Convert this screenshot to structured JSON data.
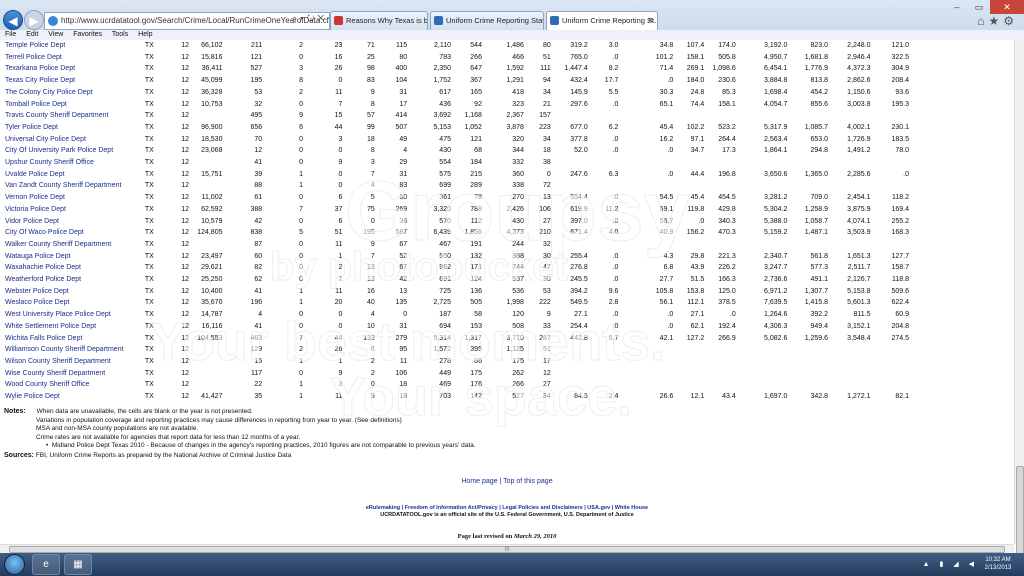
{
  "browser": {
    "url": "http://www.ucrdatatool.gov/Search/Crime/Local/RunCrimeOneYearofData.cfm",
    "tabs": [
      {
        "label": "Reasons Why Texas is better th...",
        "active": false
      },
      {
        "label": "Uniform Crime Reporting Stati...",
        "active": false
      },
      {
        "label": "Uniform Crime Reporting St...",
        "active": true
      }
    ],
    "menu": [
      "File",
      "Edit",
      "View",
      "Favorites",
      "Tools",
      "Help"
    ]
  },
  "table": {
    "rows": [
      [
        "Temple Police Dept",
        "TX",
        "12",
        "66,102",
        "211",
        "2",
        "23",
        "71",
        "115",
        "2,110",
        "544",
        "1,486",
        "80",
        "319.2",
        "3.0",
        "34.8",
        "107.4",
        "174.0",
        "3,192.0",
        "823.0",
        "2,248.0",
        "121.0"
      ],
      [
        "Terrell Police Dept",
        "TX",
        "12",
        "15,816",
        "121",
        "0",
        "16",
        "25",
        "80",
        "783",
        "266",
        "466",
        "51",
        "765.0",
        ".0",
        "101.2",
        "158.1",
        "505.8",
        "4,950.7",
        "1,681.8",
        "2,946.4",
        "322.5"
      ],
      [
        "Texarkana Police Dept",
        "TX",
        "12",
        "36,411",
        "527",
        "3",
        "26",
        "98",
        "400",
        "2,350",
        "647",
        "1,592",
        "111",
        "1,447.4",
        "8.2",
        "71.4",
        "269.1",
        "1,098.6",
        "6,454.1",
        "1,776.9",
        "4,372.3",
        "304.9"
      ],
      [
        "Texas City Police Dept",
        "TX",
        "12",
        "45,099",
        "195",
        "8",
        "0",
        "83",
        "104",
        "1,752",
        "367",
        "1,291",
        "94",
        "432.4",
        "17.7",
        ".0",
        "184.0",
        "230.6",
        "3,884.8",
        "813.8",
        "2,862.6",
        "208.4"
      ],
      [
        "The Colony City Police Dept",
        "TX",
        "12",
        "36,328",
        "53",
        "2",
        "11",
        "9",
        "31",
        "617",
        "165",
        "418",
        "34",
        "145.9",
        "5.5",
        "30.3",
        "24.8",
        "85.3",
        "1,698.4",
        "454.2",
        "1,150.6",
        "93.6"
      ],
      [
        "Tomball Police Dept",
        "TX",
        "12",
        "10,753",
        "32",
        "0",
        "7",
        "8",
        "17",
        "436",
        "92",
        "323",
        "21",
        "297.6",
        ".0",
        "65.1",
        "74.4",
        "158.1",
        "4,054.7",
        "855.6",
        "3,003.8",
        "195.3"
      ],
      [
        "Travis County Sheriff Department",
        "TX",
        "12",
        "",
        "495",
        "9",
        "15",
        "57",
        "414",
        "3,692",
        "1,168",
        "2,367",
        "157",
        "",
        "",
        "",
        "",
        "",
        "",
        "",
        "",
        ""
      ],
      [
        "Tyler Police Dept",
        "TX",
        "12",
        "96,900",
        "656",
        "6",
        "44",
        "99",
        "507",
        "5,153",
        "1,052",
        "3,878",
        "223",
        "677.0",
        "6.2",
        "45.4",
        "102.2",
        "523.2",
        "5,317.9",
        "1,085.7",
        "4,002.1",
        "230.1"
      ],
      [
        "Universal City Police Dept",
        "TX",
        "12",
        "18,530",
        "70",
        "0",
        "3",
        "18",
        "49",
        "475",
        "121",
        "320",
        "34",
        "377.8",
        ".0",
        "16.2",
        "97.1",
        "264.4",
        "2,563.4",
        "653.0",
        "1,726.9",
        "183.5"
      ],
      [
        "City Of University Park Police Dept",
        "TX",
        "12",
        "23,068",
        "12",
        "0",
        "0",
        "8",
        "4",
        "430",
        "68",
        "344",
        "18",
        "52.0",
        ".0",
        ".0",
        "34.7",
        "17.3",
        "1,864.1",
        "294.8",
        "1,491.2",
        "78.0"
      ],
      [
        "Upshur County Sheriff Office",
        "TX",
        "12",
        "",
        "41",
        "0",
        "9",
        "3",
        "29",
        "554",
        "184",
        "332",
        "38",
        "",
        "",
        "",
        "",
        "",
        "",
        "",
        "",
        ""
      ],
      [
        "Uvalde Police Dept",
        "TX",
        "12",
        "15,751",
        "39",
        "1",
        "0",
        "7",
        "31",
        "575",
        "215",
        "360",
        "0",
        "247.6",
        "6.3",
        ".0",
        "44.4",
        "196.8",
        "3,650.6",
        "1,365.0",
        "2,285.6",
        ".0"
      ],
      [
        "Van Zandt County Sheriff Department",
        "TX",
        "12",
        "",
        "88",
        "1",
        "0",
        "4",
        "83",
        "699",
        "289",
        "338",
        "72",
        "",
        "",
        "",
        "",
        "",
        "",
        "",
        "",
        ""
      ],
      [
        "Vernon Police Dept",
        "TX",
        "12",
        "11,002",
        "61",
        "0",
        "6",
        "5",
        "50",
        "361",
        "78",
        "270",
        "13",
        "554.4",
        ".0",
        "54.5",
        "45.4",
        "454.5",
        "3,281.2",
        "709.0",
        "2,454.1",
        "118.2"
      ],
      [
        "Victoria Police Dept",
        "TX",
        "12",
        "62,592",
        "388",
        "7",
        "37",
        "75",
        "269",
        "3,320",
        "788",
        "2,426",
        "106",
        "619.9",
        "11.2",
        "59.1",
        "119.8",
        "429.8",
        "5,304.2",
        "1,258.9",
        "3,875.9",
        "169.4"
      ],
      [
        "Vidor Police Dept",
        "TX",
        "12",
        "10,579",
        "42",
        "0",
        "6",
        "0",
        "36",
        "570",
        "112",
        "430",
        "27",
        "397.0",
        ".0",
        "56.7",
        ".0",
        "340.3",
        "5,388.0",
        "1,058.7",
        "4,074.1",
        "255.2"
      ],
      [
        "City Of Waco Police Dept",
        "TX",
        "12",
        "124,805",
        "838",
        "5",
        "51",
        "195",
        "587",
        "6,439",
        "1,856",
        "4,373",
        "210",
        "671.4",
        "4.0",
        "40.9",
        "156.2",
        "470.3",
        "5,159.2",
        "1,487.1",
        "3,503.9",
        "168.3"
      ],
      [
        "Walker County Sheriff Department",
        "TX",
        "12",
        "",
        "87",
        "0",
        "11",
        "9",
        "67",
        "467",
        "191",
        "244",
        "32",
        "",
        "",
        "",
        "",
        "",
        "",
        "",
        "",
        ""
      ],
      [
        "Watauga Police Dept",
        "TX",
        "12",
        "23,497",
        "60",
        "0",
        "1",
        "7",
        "52",
        "550",
        "132",
        "388",
        "30",
        "255.4",
        ".0",
        "4.3",
        "29.8",
        "221.3",
        "2,340.7",
        "561.8",
        "1,651.3",
        "127.7"
      ],
      [
        "Waxahachie Police Dept",
        "TX",
        "12",
        "29,621",
        "82",
        "0",
        "2",
        "13",
        "67",
        "962",
        "171",
        "744",
        "47",
        "276.8",
        ".0",
        "6.8",
        "43.9",
        "226.2",
        "3,247.7",
        "577.3",
        "2,511.7",
        "158.7"
      ],
      [
        "Weatherford Police Dept",
        "TX",
        "12",
        "25,250",
        "62",
        "0",
        "7",
        "13",
        "42",
        "691",
        "124",
        "537",
        "30",
        "245.5",
        ".0",
        "27.7",
        "51.5",
        "166.3",
        "2,736.6",
        "491.1",
        "2,126.7",
        "118.8"
      ],
      [
        "Webster Police Dept",
        "TX",
        "12",
        "10,400",
        "41",
        "1",
        "11",
        "16",
        "13",
        "725",
        "136",
        "536",
        "53",
        "394.2",
        "9.6",
        "105.8",
        "153.8",
        "125.0",
        "6,971.2",
        "1,307.7",
        "5,153.8",
        "509.6"
      ],
      [
        "Weslaco Police Dept",
        "TX",
        "12",
        "35,670",
        "196",
        "1",
        "20",
        "40",
        "135",
        "2,725",
        "505",
        "1,998",
        "222",
        "549.5",
        "2.8",
        "56.1",
        "112.1",
        "378.5",
        "7,639.5",
        "1,415.8",
        "5,601.3",
        "622.4"
      ],
      [
        "West University Place Police Dept",
        "TX",
        "12",
        "14,787",
        "4",
        "0",
        "0",
        "4",
        "0",
        "187",
        "58",
        "120",
        "9",
        "27.1",
        ".0",
        ".0",
        "27.1",
        ".0",
        "1,264.6",
        "392.2",
        "811.5",
        "60.9"
      ],
      [
        "White Settlement Police Dept",
        "TX",
        "12",
        "16,116",
        "41",
        "0",
        "0",
        "10",
        "31",
        "694",
        "153",
        "508",
        "33",
        "254.4",
        ".0",
        ".0",
        "62.1",
        "192.4",
        "4,306.3",
        "949.4",
        "3,152.1",
        "204.8"
      ],
      [
        "Wichita Falls Police Dept",
        "TX",
        "12",
        "104,553",
        "463",
        "7",
        "44",
        "133",
        "279",
        "5,314",
        "1,317",
        "3,710",
        "287",
        "442.8",
        "6.7",
        "42.1",
        "127.2",
        "266.9",
        "5,082.6",
        "1,259.6",
        "3,548.4",
        "274.5"
      ],
      [
        "Williamson County Sheriff Department",
        "TX",
        "12",
        "",
        "129",
        "2",
        "26",
        "6",
        "95",
        "1,572",
        "395",
        "1,125",
        "51",
        "",
        "",
        "",
        "",
        "",
        "",
        "",
        "",
        ""
      ],
      [
        "Wilson County Sheriff Department",
        "TX",
        "12",
        "",
        "15",
        "1",
        "1",
        "2",
        "11",
        "278",
        "86",
        "175",
        "17",
        "",
        "",
        "",
        "",
        "",
        "",
        "",
        "",
        ""
      ],
      [
        "Wise County Sheriff Department",
        "TX",
        "12",
        "",
        "117",
        "0",
        "9",
        "2",
        "106",
        "449",
        "175",
        "262",
        "12",
        "",
        "",
        "",
        "",
        "",
        "",
        "",
        "",
        ""
      ],
      [
        "Wood County Sheriff Office",
        "TX",
        "12",
        "",
        "22",
        "1",
        "3",
        "0",
        "18",
        "469",
        "176",
        "266",
        "27",
        "",
        "",
        "",
        "",
        "",
        "",
        "",
        "",
        ""
      ],
      [
        "Wylie Police Dept",
        "TX",
        "12",
        "41,427",
        "35",
        "1",
        "11",
        "5",
        "18",
        "703",
        "142",
        "527",
        "34",
        "84.5",
        "2.4",
        "26.6",
        "12.1",
        "43.4",
        "1,697.0",
        "342.8",
        "1,272.1",
        "82.1"
      ]
    ]
  },
  "notes": {
    "label": "Notes:",
    "line1": "When data are unavailable, the cells are blank or the year is not presented.",
    "line2": "Variations in population coverage and reporting practices may cause differences in reporting from year to year. (See definitions)",
    "line3": "MSA and non-MSA county populations are not available.",
    "line4": "Crime rates are not available for agencies that report data for less than 12 months of a year.",
    "bullet": "Midland Police Dept Texas 2010 - Because of changes in the agency's reporting practices, 2010 figures are not comparable to previous years' data.",
    "sources_label": "Sources:",
    "sources": "FBI, Uniform Crime Reports as prepared by the National Archive of Criminal Justice Data"
  },
  "footer": {
    "home": "Home page",
    "sep": " | ",
    "top": "Top of this page",
    "links": "eRulemaking | Freedom of Information Act/Privacy | Legal Policies and Disclaimers | USA.gov | White House",
    "official": "UCRDATATOOL.gov is an official site of the U.S. Federal Government, U.S. Department of Justice",
    "revised_prefix": "Page last revised on ",
    "revised_date": "March 29, 2010"
  },
  "taskbar": {
    "time": "10:32 AM",
    "date": "2/13/2013"
  },
  "colors": {
    "link": "#1c2e8c",
    "chrome": "#c9d8ec",
    "taskbar": "#2c4668"
  }
}
